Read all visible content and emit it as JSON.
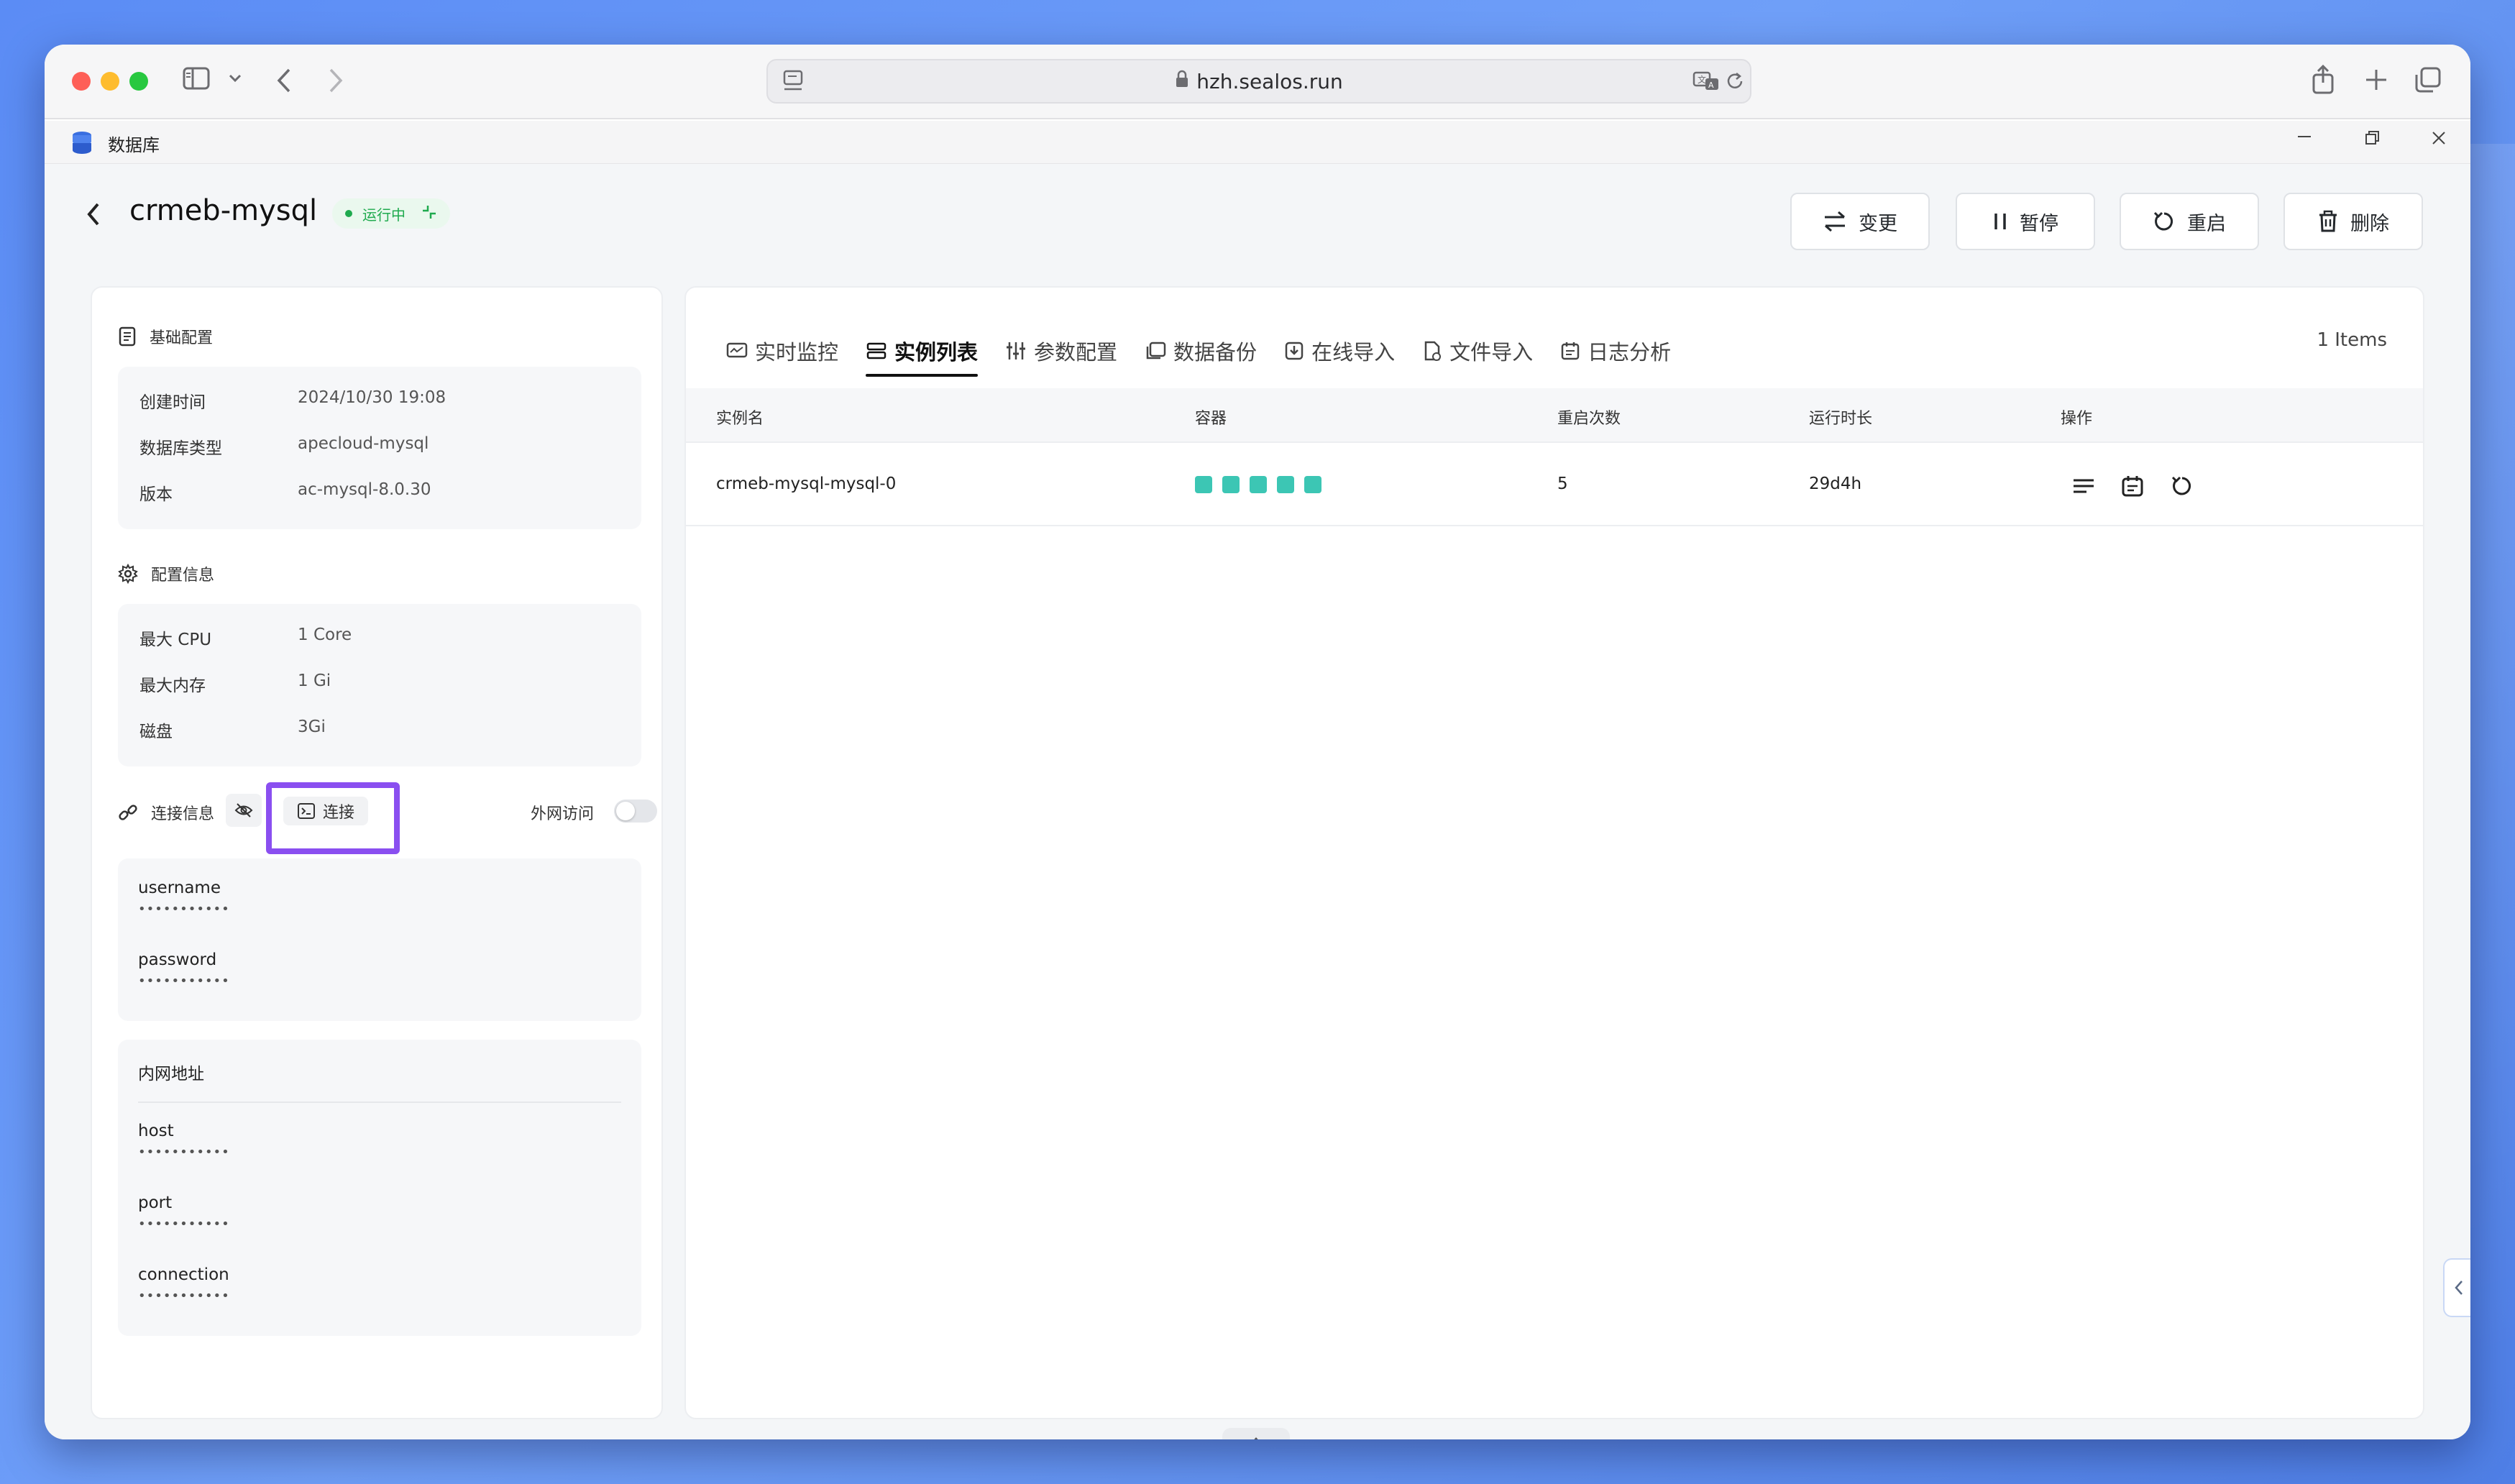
{
  "browser": {
    "url": "hzh.sealos.run"
  },
  "app": {
    "name": "数据库"
  },
  "header": {
    "title": "crmeb-mysql",
    "status": "运行中",
    "actions": [
      {
        "label": "变更",
        "icon": "swap-icon"
      },
      {
        "label": "暂停",
        "icon": "pause-icon"
      },
      {
        "label": "重启",
        "icon": "restart-icon"
      },
      {
        "label": "删除",
        "icon": "trash-icon"
      }
    ]
  },
  "left": {
    "basic": {
      "title": "基础配置",
      "rows": [
        {
          "k": "创建时间",
          "v": "2024/10/30 19:08"
        },
        {
          "k": "数据库类型",
          "v": "apecloud-mysql"
        },
        {
          "k": "版本",
          "v": "ac-mysql-8.0.30"
        }
      ]
    },
    "config": {
      "title": "配置信息",
      "rows": [
        {
          "k": "最大 CPU",
          "v": "1 Core"
        },
        {
          "k": "最大内存",
          "v": "1 Gi"
        },
        {
          "k": "磁盘",
          "v": "3Gi"
        }
      ]
    },
    "connection": {
      "title": "连接信息",
      "connect_label": "连接",
      "external_label": "外网访问",
      "external_enabled": false,
      "creds": [
        {
          "label": "username",
          "mask": "•••••••••••"
        },
        {
          "label": "password",
          "mask": "•••••••••••"
        }
      ]
    },
    "internal": {
      "title": "内网地址",
      "fields": [
        {
          "label": "host",
          "mask": "•••••••••••"
        },
        {
          "label": "port",
          "mask": "•••••••••••"
        },
        {
          "label": "connection",
          "mask": "•••••••••••"
        }
      ]
    }
  },
  "right": {
    "tabs": [
      {
        "label": "实时监控",
        "icon": "monitor-icon"
      },
      {
        "label": "实例列表",
        "icon": "list-icon"
      },
      {
        "label": "参数配置",
        "icon": "sliders-icon"
      },
      {
        "label": "数据备份",
        "icon": "backup-icon"
      },
      {
        "label": "在线导入",
        "icon": "import-icon"
      },
      {
        "label": "文件导入",
        "icon": "file-import-icon"
      },
      {
        "label": "日志分析",
        "icon": "log-icon"
      }
    ],
    "active_tab": "实例列表",
    "items_count": "1 Items",
    "columns": [
      "实例名",
      "容器",
      "重启次数",
      "运行时长",
      "操作"
    ],
    "rows": [
      {
        "name": "crmeb-mysql-mysql-0",
        "containers": 5,
        "restarts": "5",
        "uptime": "29d4h"
      }
    ]
  },
  "colors": {
    "accent": "#8a4ff0",
    "status_green": "#1faa4e",
    "container_teal": "#3cc6b4"
  }
}
